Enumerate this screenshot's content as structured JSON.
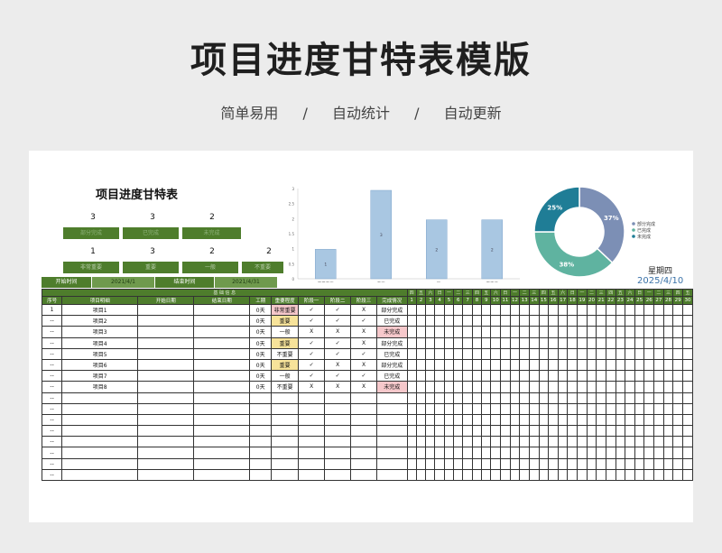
{
  "header": {
    "title": "项目进度甘特表模版",
    "tags": [
      "简单易用",
      "/",
      "自动统计",
      "/",
      "自动更新"
    ]
  },
  "sheet": {
    "title": "项目进度甘特表",
    "stats_row1": {
      "values": [
        "3",
        "3",
        "2"
      ],
      "labels": [
        "部分完成",
        "已完成",
        "未完成"
      ]
    },
    "stats_row2": {
      "values": [
        "1",
        "3",
        "2",
        "2"
      ],
      "labels": [
        "非常重要",
        "重要",
        "一般",
        "不重要"
      ]
    },
    "dates": {
      "start_label": "开始时间",
      "start_value": "2021/4/1",
      "end_label": "结束时间",
      "end_value": "2021/4/31"
    },
    "weekday": "星期四",
    "today": "2025/4/10"
  },
  "bar_chart": {
    "chart_data": {
      "type": "bar",
      "categories": [
        "非常重要",
        "重要",
        "一般",
        "不重要"
      ],
      "values": [
        1,
        3,
        2,
        2
      ],
      "ylim": [
        0,
        3
      ],
      "yticks": [
        "0",
        "0.5",
        "1",
        "1.5",
        "2",
        "2.5",
        "3"
      ],
      "color": "#a9c7e2"
    }
  },
  "pie_chart": {
    "chart_data": {
      "type": "pie",
      "categories": [
        "部分完成",
        "已完成",
        "未完成"
      ],
      "values": [
        37,
        38,
        25
      ],
      "labels": [
        "37%",
        "38%",
        "25%"
      ],
      "colors": [
        "#7c8fb5",
        "#5fb3a0",
        "#1f7d96"
      ],
      "legend_position": "right"
    }
  },
  "table": {
    "group_header": "基 础 信 息",
    "columns": [
      "序号",
      "项目明细",
      "开始日期",
      "结束日期",
      "工期",
      "重要程度",
      "阶段一",
      "阶段二",
      "阶段三",
      "完成情况"
    ],
    "weekdays": [
      "四",
      "五",
      "六",
      "日",
      "一",
      "二",
      "三",
      "四",
      "五",
      "六",
      "日",
      "一",
      "二",
      "三",
      "四",
      "五",
      "六",
      "日",
      "一",
      "二",
      "三",
      "四",
      "五",
      "六",
      "日",
      "一",
      "二",
      "三",
      "四",
      "五"
    ],
    "days": [
      "1",
      "2",
      "3",
      "4",
      "5",
      "6",
      "7",
      "8",
      "9",
      "10",
      "11",
      "12",
      "13",
      "14",
      "15",
      "16",
      "17",
      "18",
      "19",
      "20",
      "21",
      "22",
      "23",
      "24",
      "25",
      "26",
      "27",
      "28",
      "29",
      "30"
    ],
    "rows": [
      {
        "no": "1",
        "name": "项目1",
        "start": "",
        "end": "",
        "dur": "0天",
        "pri": "非常重要",
        "pc": "r",
        "s1": "✓",
        "s2": "✓",
        "s3": "X",
        "status": "部分完成",
        "sc": ""
      },
      {
        "no": "--",
        "name": "项目2",
        "start": "",
        "end": "",
        "dur": "0天",
        "pri": "重要",
        "pc": "y",
        "s1": "✓",
        "s2": "✓",
        "s3": "✓",
        "status": "已完成",
        "sc": ""
      },
      {
        "no": "--",
        "name": "项目3",
        "start": "",
        "end": "",
        "dur": "0天",
        "pri": "一般",
        "pc": "b",
        "s1": "X",
        "s2": "X",
        "s3": "X",
        "status": "未完成",
        "sc": "r"
      },
      {
        "no": "--",
        "name": "项目4",
        "start": "",
        "end": "",
        "dur": "0天",
        "pri": "重要",
        "pc": "y",
        "s1": "✓",
        "s2": "✓",
        "s3": "X",
        "status": "部分完成",
        "sc": ""
      },
      {
        "no": "--",
        "name": "项目5",
        "start": "",
        "end": "",
        "dur": "0天",
        "pri": "不重要",
        "pc": "g",
        "s1": "✓",
        "s2": "✓",
        "s3": "✓",
        "status": "已完成",
        "sc": ""
      },
      {
        "no": "--",
        "name": "项目6",
        "start": "",
        "end": "",
        "dur": "0天",
        "pri": "重要",
        "pc": "y",
        "s1": "✓",
        "s2": "X",
        "s3": "X",
        "status": "部分完成",
        "sc": ""
      },
      {
        "no": "--",
        "name": "项目7",
        "start": "",
        "end": "",
        "dur": "0天",
        "pri": "一般",
        "pc": "b",
        "s1": "✓",
        "s2": "✓",
        "s3": "✓",
        "status": "已完成",
        "sc": ""
      },
      {
        "no": "--",
        "name": "项目8",
        "start": "",
        "end": "",
        "dur": "0天",
        "pri": "不重要",
        "pc": "g",
        "s1": "X",
        "s2": "X",
        "s3": "X",
        "status": "未完成",
        "sc": "r"
      },
      {
        "no": "--",
        "name": "",
        "start": "",
        "end": "",
        "dur": "",
        "pri": "",
        "pc": "",
        "s1": "",
        "s2": "",
        "s3": "",
        "status": "",
        "sc": ""
      },
      {
        "no": "--",
        "name": "",
        "start": "",
        "end": "",
        "dur": "",
        "pri": "",
        "pc": "",
        "s1": "",
        "s2": "",
        "s3": "",
        "status": "",
        "sc": ""
      },
      {
        "no": "--",
        "name": "",
        "start": "",
        "end": "",
        "dur": "",
        "pri": "",
        "pc": "",
        "s1": "",
        "s2": "",
        "s3": "",
        "status": "",
        "sc": ""
      },
      {
        "no": "--",
        "name": "",
        "start": "",
        "end": "",
        "dur": "",
        "pri": "",
        "pc": "",
        "s1": "",
        "s2": "",
        "s3": "",
        "status": "",
        "sc": ""
      },
      {
        "no": "--",
        "name": "",
        "start": "",
        "end": "",
        "dur": "",
        "pri": "",
        "pc": "",
        "s1": "",
        "s2": "",
        "s3": "",
        "status": "",
        "sc": ""
      },
      {
        "no": "--",
        "name": "",
        "start": "",
        "end": "",
        "dur": "",
        "pri": "",
        "pc": "",
        "s1": "",
        "s2": "",
        "s3": "",
        "status": "",
        "sc": ""
      },
      {
        "no": "--",
        "name": "",
        "start": "",
        "end": "",
        "dur": "",
        "pri": "",
        "pc": "",
        "s1": "",
        "s2": "",
        "s3": "",
        "status": "",
        "sc": ""
      },
      {
        "no": "--",
        "name": "",
        "start": "",
        "end": "",
        "dur": "",
        "pri": "",
        "pc": "",
        "s1": "",
        "s2": "",
        "s3": "",
        "status": "",
        "sc": ""
      }
    ]
  }
}
